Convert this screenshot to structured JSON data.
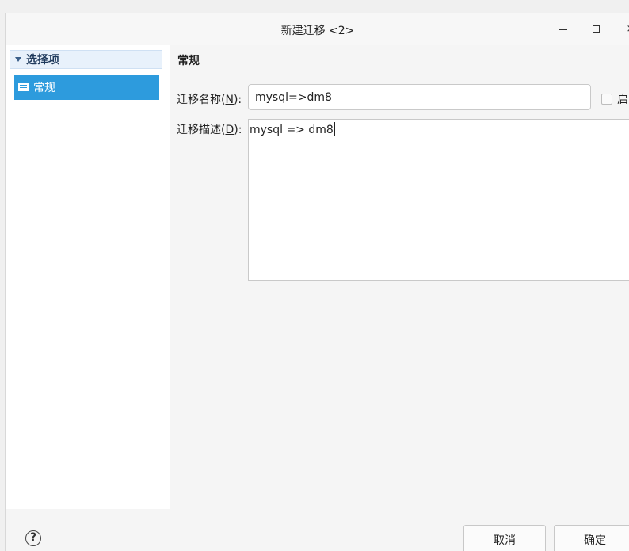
{
  "window": {
    "title": "新建迁移 <2>",
    "controls": {
      "minimize": "minimize-icon",
      "maximize": "maximize-icon",
      "close_glyph": "×"
    }
  },
  "sidebar": {
    "group_label": "选择项",
    "items": [
      {
        "label": "常规",
        "icon": "list-icon",
        "selected": true
      }
    ]
  },
  "main": {
    "section_title": "常规",
    "name_label_prefix": "迁移名称(",
    "name_label_key": "N",
    "name_label_suffix": "):",
    "name_value": "mysql=>dm8",
    "checkbox_label": "启",
    "checkbox_checked": false,
    "desc_label_prefix": "迁移描述(",
    "desc_label_key": "D",
    "desc_label_suffix": "):",
    "desc_value": "mysql => dm8"
  },
  "footer": {
    "help_glyph": "?",
    "cancel_label": "取消",
    "ok_label": "确定"
  },
  "colors": {
    "accent": "#2d9bdd",
    "tree_header_bg": "#e8f1fb"
  }
}
